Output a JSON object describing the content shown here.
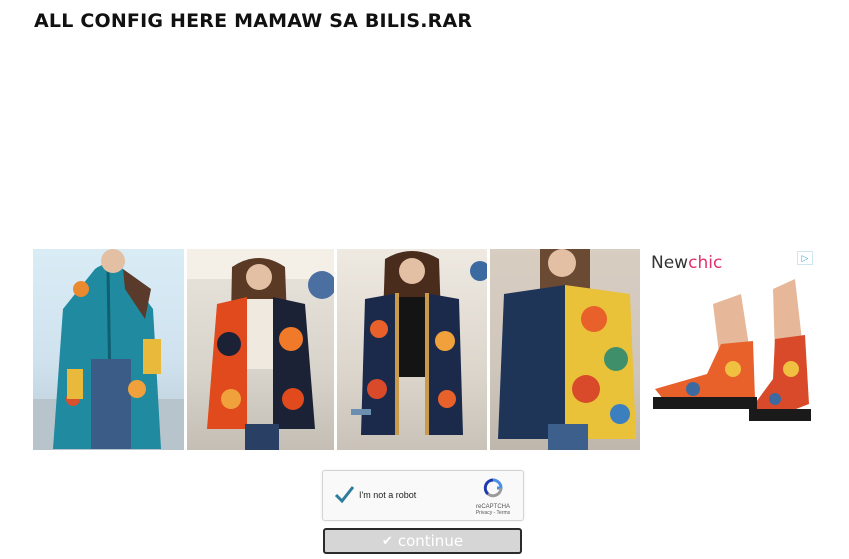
{
  "page": {
    "title": "ALL CONFIG HERE MAMAW SA BILIS.RAR"
  },
  "ad": {
    "brand_prefix": "New",
    "brand_suffix": "chic",
    "brand_accent_color": "#e0316b",
    "adchoices_icon": "adchoices-icon",
    "products": [
      {
        "icon": "teal-coat-image"
      },
      {
        "icon": "patterned-cardigan-image"
      },
      {
        "icon": "floral-jacket-image"
      },
      {
        "icon": "patchwork-shirt-image"
      },
      {
        "icon": "floral-boots-image"
      }
    ]
  },
  "captcha": {
    "label": "I'm not a robot",
    "brand": "reCAPTCHA",
    "links": "Privacy - Terms",
    "check_color": "#2e7d9e"
  },
  "action": {
    "continue_label": "continue",
    "button_color": "#d6d6d6"
  }
}
